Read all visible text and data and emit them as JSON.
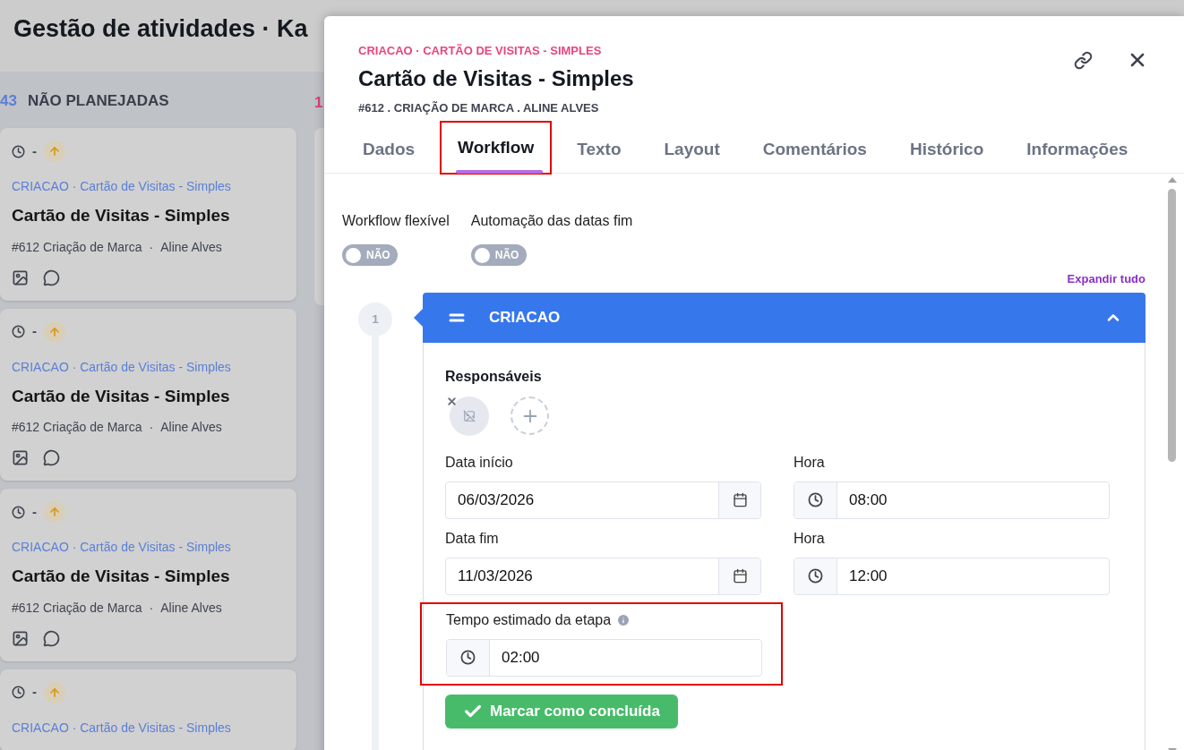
{
  "page": {
    "title": "Gestão de atividades · Ka"
  },
  "columns": [
    {
      "count": "43",
      "color": "#5b7fd6",
      "title": "NÃO PLANEJADAS",
      "cards": [
        {
          "time": "-",
          "path": "CRIACAO · Cartão de Visitas - Simples",
          "title": "Cartão de Visitas - Simples",
          "project": "#612 Criação de Marca",
          "separator": "·",
          "person": "Aline Alves"
        },
        {
          "time": "-",
          "path": "CRIACAO · Cartão de Visitas - Simples",
          "title": "Cartão de Visitas - Simples",
          "project": "#612 Criação de Marca",
          "separator": "·",
          "person": "Aline Alves"
        },
        {
          "time": "-",
          "path": "CRIACAO · Cartão de Visitas - Simples",
          "title": "Cartão de Visitas - Simples",
          "project": "#612 Criação de Marca",
          "separator": "·",
          "person": "Aline Alves"
        },
        {
          "time": "-",
          "path": "CRIACAO · Cartão de Visitas - Simples"
        }
      ]
    },
    {
      "count": "1",
      "color": "#d9437a"
    }
  ],
  "modal": {
    "breadcrumb": "CRIACAO · CARTÃO DE VISITAS - SIMPLES",
    "title": "Cartão de Visitas - Simples",
    "subtitle": "#612 . CRIAÇÃO DE MARCA . ALINE ALVES",
    "tabs": [
      {
        "label": "Dados",
        "selected": false,
        "highlighted": false
      },
      {
        "label": "Workflow",
        "selected": true,
        "highlighted": true
      },
      {
        "label": "Texto",
        "selected": false,
        "highlighted": false
      },
      {
        "label": "Layout",
        "selected": false,
        "highlighted": false
      },
      {
        "label": "Comentários",
        "selected": false,
        "highlighted": false
      },
      {
        "label": "Histórico",
        "selected": false,
        "highlighted": false
      },
      {
        "label": "Informações",
        "selected": false,
        "highlighted": false
      }
    ],
    "toggles": [
      {
        "label": "Workflow flexível",
        "on": false,
        "text": "NÃO"
      },
      {
        "label": "Automação das datas fim",
        "on": false,
        "text": "NÃO"
      }
    ],
    "expand_all": "Expandir tudo",
    "stages": [
      {
        "number": "1",
        "name": "CRIACAO",
        "expanded": true,
        "responsibles_label": "Responsáveis",
        "fields": [
          {
            "label": "Data início",
            "value": "06/03/2026",
            "kind": "date"
          },
          {
            "label": "Hora",
            "value": "08:00",
            "kind": "time"
          },
          {
            "label": "Data fim",
            "value": "11/03/2026",
            "kind": "date"
          },
          {
            "label": "Hora",
            "value": "12:00",
            "kind": "time"
          }
        ],
        "estimate": {
          "label": "Tempo estimado da etapa",
          "value": "02:00",
          "kind": "time",
          "highlighted": true
        },
        "complete_button": "Marcar como concluída"
      }
    ]
  }
}
